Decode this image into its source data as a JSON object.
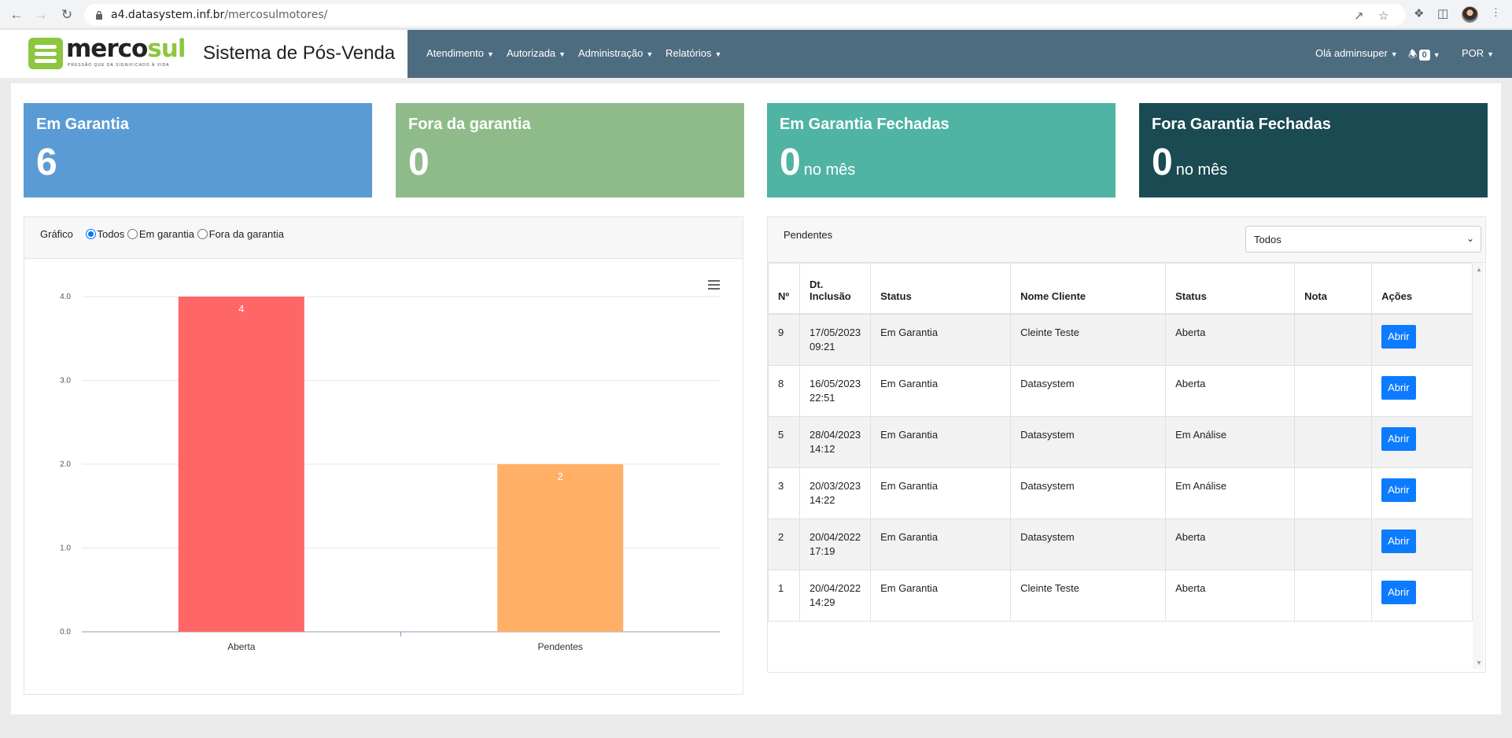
{
  "browser": {
    "url_host": "a4.datasystem.inf.br",
    "url_path": "/mercosulmotores/"
  },
  "header": {
    "logo_brand_1": "merco",
    "logo_brand_2": "sul",
    "logo_tagline": "PRESSÃO QUE DÁ SIGNIFICADO À VIDA",
    "system_title": "Sistema de Pós-Venda",
    "nav": [
      "Atendimento",
      "Autorizada",
      "Administração",
      "Relatórios"
    ],
    "user_greeting": "Olá adminsuper",
    "notifications_count": "0",
    "language": "POR"
  },
  "cards": [
    {
      "title": "Em Garantia",
      "value": "6",
      "suffix": "",
      "color": "#5b9bd5"
    },
    {
      "title": "Fora da garantia",
      "value": "0",
      "suffix": "",
      "color": "#8fbb8b"
    },
    {
      "title": "Em Garantia Fechadas",
      "value": "0",
      "suffix": "no mês",
      "color": "#4fb4a3"
    },
    {
      "title": "Fora Garantia Fechadas",
      "value": "0",
      "suffix": "no mês",
      "color": "#1a4a52"
    }
  ],
  "chart_panel": {
    "label": "Gráfico",
    "options": [
      "Todos",
      "Em garantia",
      "Fora da garantia"
    ],
    "selected": "Todos"
  },
  "chart_data": {
    "type": "bar",
    "categories": [
      "Aberta",
      "Pendentes"
    ],
    "values": [
      4,
      2
    ],
    "colors": [
      "#ff6666",
      "#ffb066"
    ],
    "ylim": [
      0,
      4
    ],
    "yticks": [
      "0.0",
      "1.0",
      "2.0",
      "3.0",
      "4.0"
    ],
    "grid": true
  },
  "pending": {
    "title": "Pendentes",
    "filter_value": "Todos",
    "columns": [
      "Nº",
      "Dt. Inclusão",
      "Status",
      "Nome Cliente",
      "Status",
      "Nota",
      "Ações"
    ],
    "rows": [
      {
        "num": "9",
        "date": "17/05/2023",
        "time": "09:21",
        "status": "Em Garantia",
        "client": "Cleinte Teste",
        "state": "Aberta",
        "note": "",
        "action": "Abrir"
      },
      {
        "num": "8",
        "date": "16/05/2023",
        "time": "22:51",
        "status": "Em Garantia",
        "client": "Datasystem",
        "state": "Aberta",
        "note": "",
        "action": "Abrir"
      },
      {
        "num": "5",
        "date": "28/04/2023",
        "time": "14:12",
        "status": "Em Garantia",
        "client": "Datasystem",
        "state": "Em Análise",
        "note": "",
        "action": "Abrir"
      },
      {
        "num": "3",
        "date": "20/03/2023",
        "time": "14:22",
        "status": "Em Garantia",
        "client": "Datasystem",
        "state": "Em Análise",
        "note": "",
        "action": "Abrir"
      },
      {
        "num": "2",
        "date": "20/04/2022",
        "time": "17:19",
        "status": "Em Garantia",
        "client": "Datasystem",
        "state": "Aberta",
        "note": "",
        "action": "Abrir"
      },
      {
        "num": "1",
        "date": "20/04/2022",
        "time": "14:29",
        "status": "Em Garantia",
        "client": "Cleinte Teste",
        "state": "Aberta",
        "note": "",
        "action": "Abrir"
      }
    ]
  }
}
